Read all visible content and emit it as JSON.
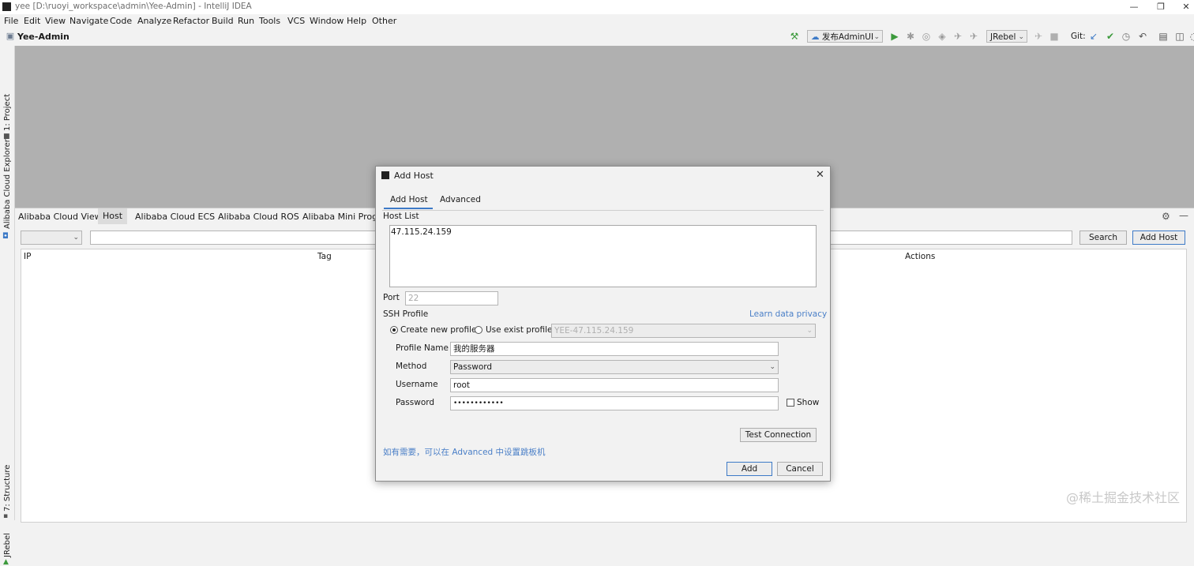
{
  "window": {
    "title": "yee [D:\\ruoyi_workspace\\admin\\Yee-Admin] - IntelliJ IDEA",
    "minimize": "—",
    "restore": "❐",
    "close": "✕"
  },
  "menu": [
    "File",
    "Edit",
    "View",
    "Navigate",
    "Code",
    "Analyze",
    "Refactor",
    "Build",
    "Run",
    "Tools",
    "VCS",
    "Window",
    "Help",
    "Other"
  ],
  "toolbar": {
    "project_name": "Yee-Admin",
    "run_config": "发布AdminUI",
    "jrebel": "JRebel",
    "git_label": "Git:"
  },
  "side_tabs": {
    "project": "1: Project",
    "cloud_explorer": "Alibaba Cloud Explorer",
    "structure": "7: Structure",
    "jrebel": "JRebel"
  },
  "tool_window": {
    "view_label": "Alibaba Cloud View:",
    "tabs": [
      "Host",
      "Alibaba Cloud ECS",
      "Alibaba Cloud ROS",
      "Alibaba Mini Progra"
    ],
    "search_button": "Search",
    "add_host_button": "Add Host",
    "columns": {
      "ip": "IP",
      "tag": "Tag",
      "actions": "Actions"
    }
  },
  "dialog": {
    "title": "Add Host",
    "tabs": [
      "Add Host",
      "Advanced"
    ],
    "host_list_label": "Host List",
    "host_list_value": "47.115.24.159",
    "port_label": "Port",
    "port_placeholder": "22",
    "ssh_profile_label": "SSH Profile",
    "learn_privacy": "Learn data privacy",
    "create_new_profile": "Create new profile",
    "use_exist_profile": "Use exist profile",
    "exist_profile_value": "YEE-47.115.24.159",
    "profile_name_label": "Profile Name",
    "profile_name_value": "我的服务器",
    "method_label": "Method",
    "method_value": "Password",
    "username_label": "Username",
    "username_value": "root",
    "password_label": "Password",
    "password_value": "••••••••••••",
    "show_label": "Show",
    "test_connection": "Test Connection",
    "hint": "如有需要，可以在 Advanced 中设置跳板机",
    "add_button": "Add",
    "cancel_button": "Cancel"
  },
  "watermark": "@稀土掘金技术社区",
  "colors": {
    "accent": "#3d7ac7",
    "editor_bg": "#b0b0b0",
    "link": "#4a7fc7",
    "run_green": "#3c9a3c"
  }
}
